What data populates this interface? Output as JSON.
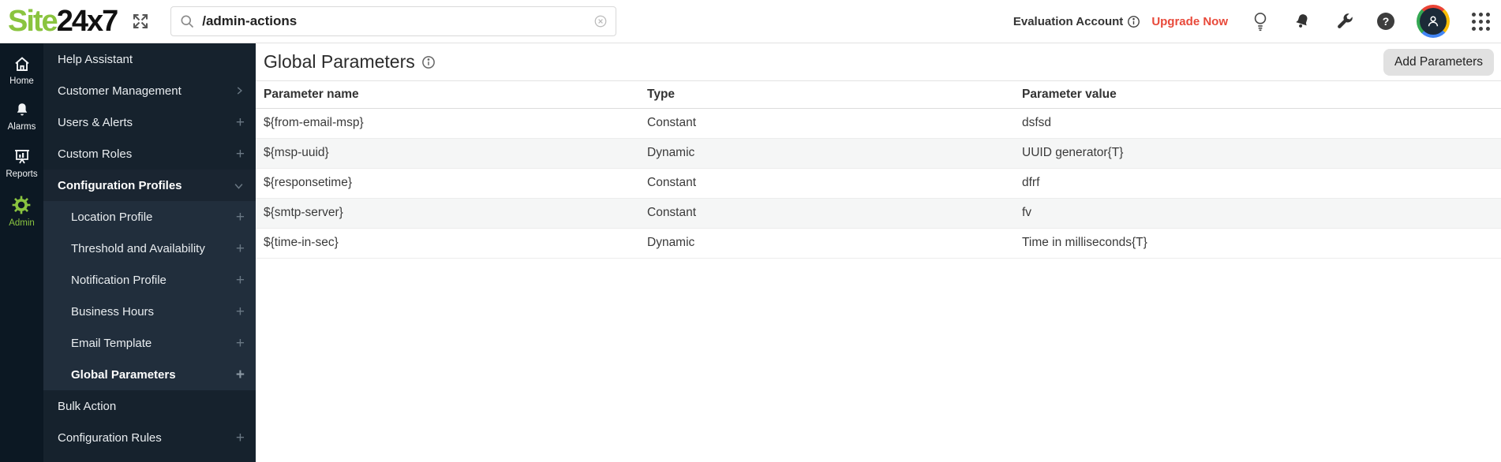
{
  "brand": {
    "name_green": "Site",
    "name_black": "24x7"
  },
  "topbar": {
    "search_value": "/admin-actions",
    "account_label": "Evaluation Account",
    "upgrade_label": "Upgrade Now"
  },
  "icons": {
    "plus": "+",
    "question_mark": "?"
  },
  "rail": {
    "items": [
      {
        "label": "Home"
      },
      {
        "label": "Alarms"
      },
      {
        "label": "Reports"
      },
      {
        "label": "Admin"
      }
    ]
  },
  "sidebar": {
    "items": [
      {
        "label": "Help Assistant",
        "suffix": "none"
      },
      {
        "label": "Customer Management",
        "suffix": "chevron-right"
      },
      {
        "label": "Users & Alerts",
        "suffix": "plus"
      },
      {
        "label": "Custom Roles",
        "suffix": "plus"
      },
      {
        "label": "Configuration Profiles",
        "suffix": "chevron-down",
        "expanded": true
      },
      {
        "label": "Location Profile",
        "suffix": "plus",
        "sub": true
      },
      {
        "label": "Threshold and Availability",
        "suffix": "plus",
        "sub": true
      },
      {
        "label": "Notification Profile",
        "suffix": "plus",
        "sub": true
      },
      {
        "label": "Business Hours",
        "suffix": "plus",
        "sub": true
      },
      {
        "label": "Email Template",
        "suffix": "plus",
        "sub": true
      },
      {
        "label": "Global Parameters",
        "suffix": "plus",
        "sub": true,
        "selected": true
      },
      {
        "label": "Bulk Action",
        "suffix": "none"
      },
      {
        "label": "Configuration Rules",
        "suffix": "plus"
      }
    ]
  },
  "main": {
    "title": "Global Parameters",
    "add_button": "Add Parameters",
    "table": {
      "headers": [
        "Parameter name",
        "Type",
        "Parameter value"
      ],
      "rows": [
        [
          "${from-email-msp}",
          "Constant",
          "dsfsd"
        ],
        [
          "${msp-uuid}",
          "Dynamic",
          "UUID generator{T}"
        ],
        [
          "${responsetime}",
          "Constant",
          "dfrf"
        ],
        [
          "${smtp-server}",
          "Constant",
          "fv"
        ],
        [
          "${time-in-sec}",
          "Dynamic",
          "Time in milliseconds{T}"
        ]
      ]
    }
  }
}
